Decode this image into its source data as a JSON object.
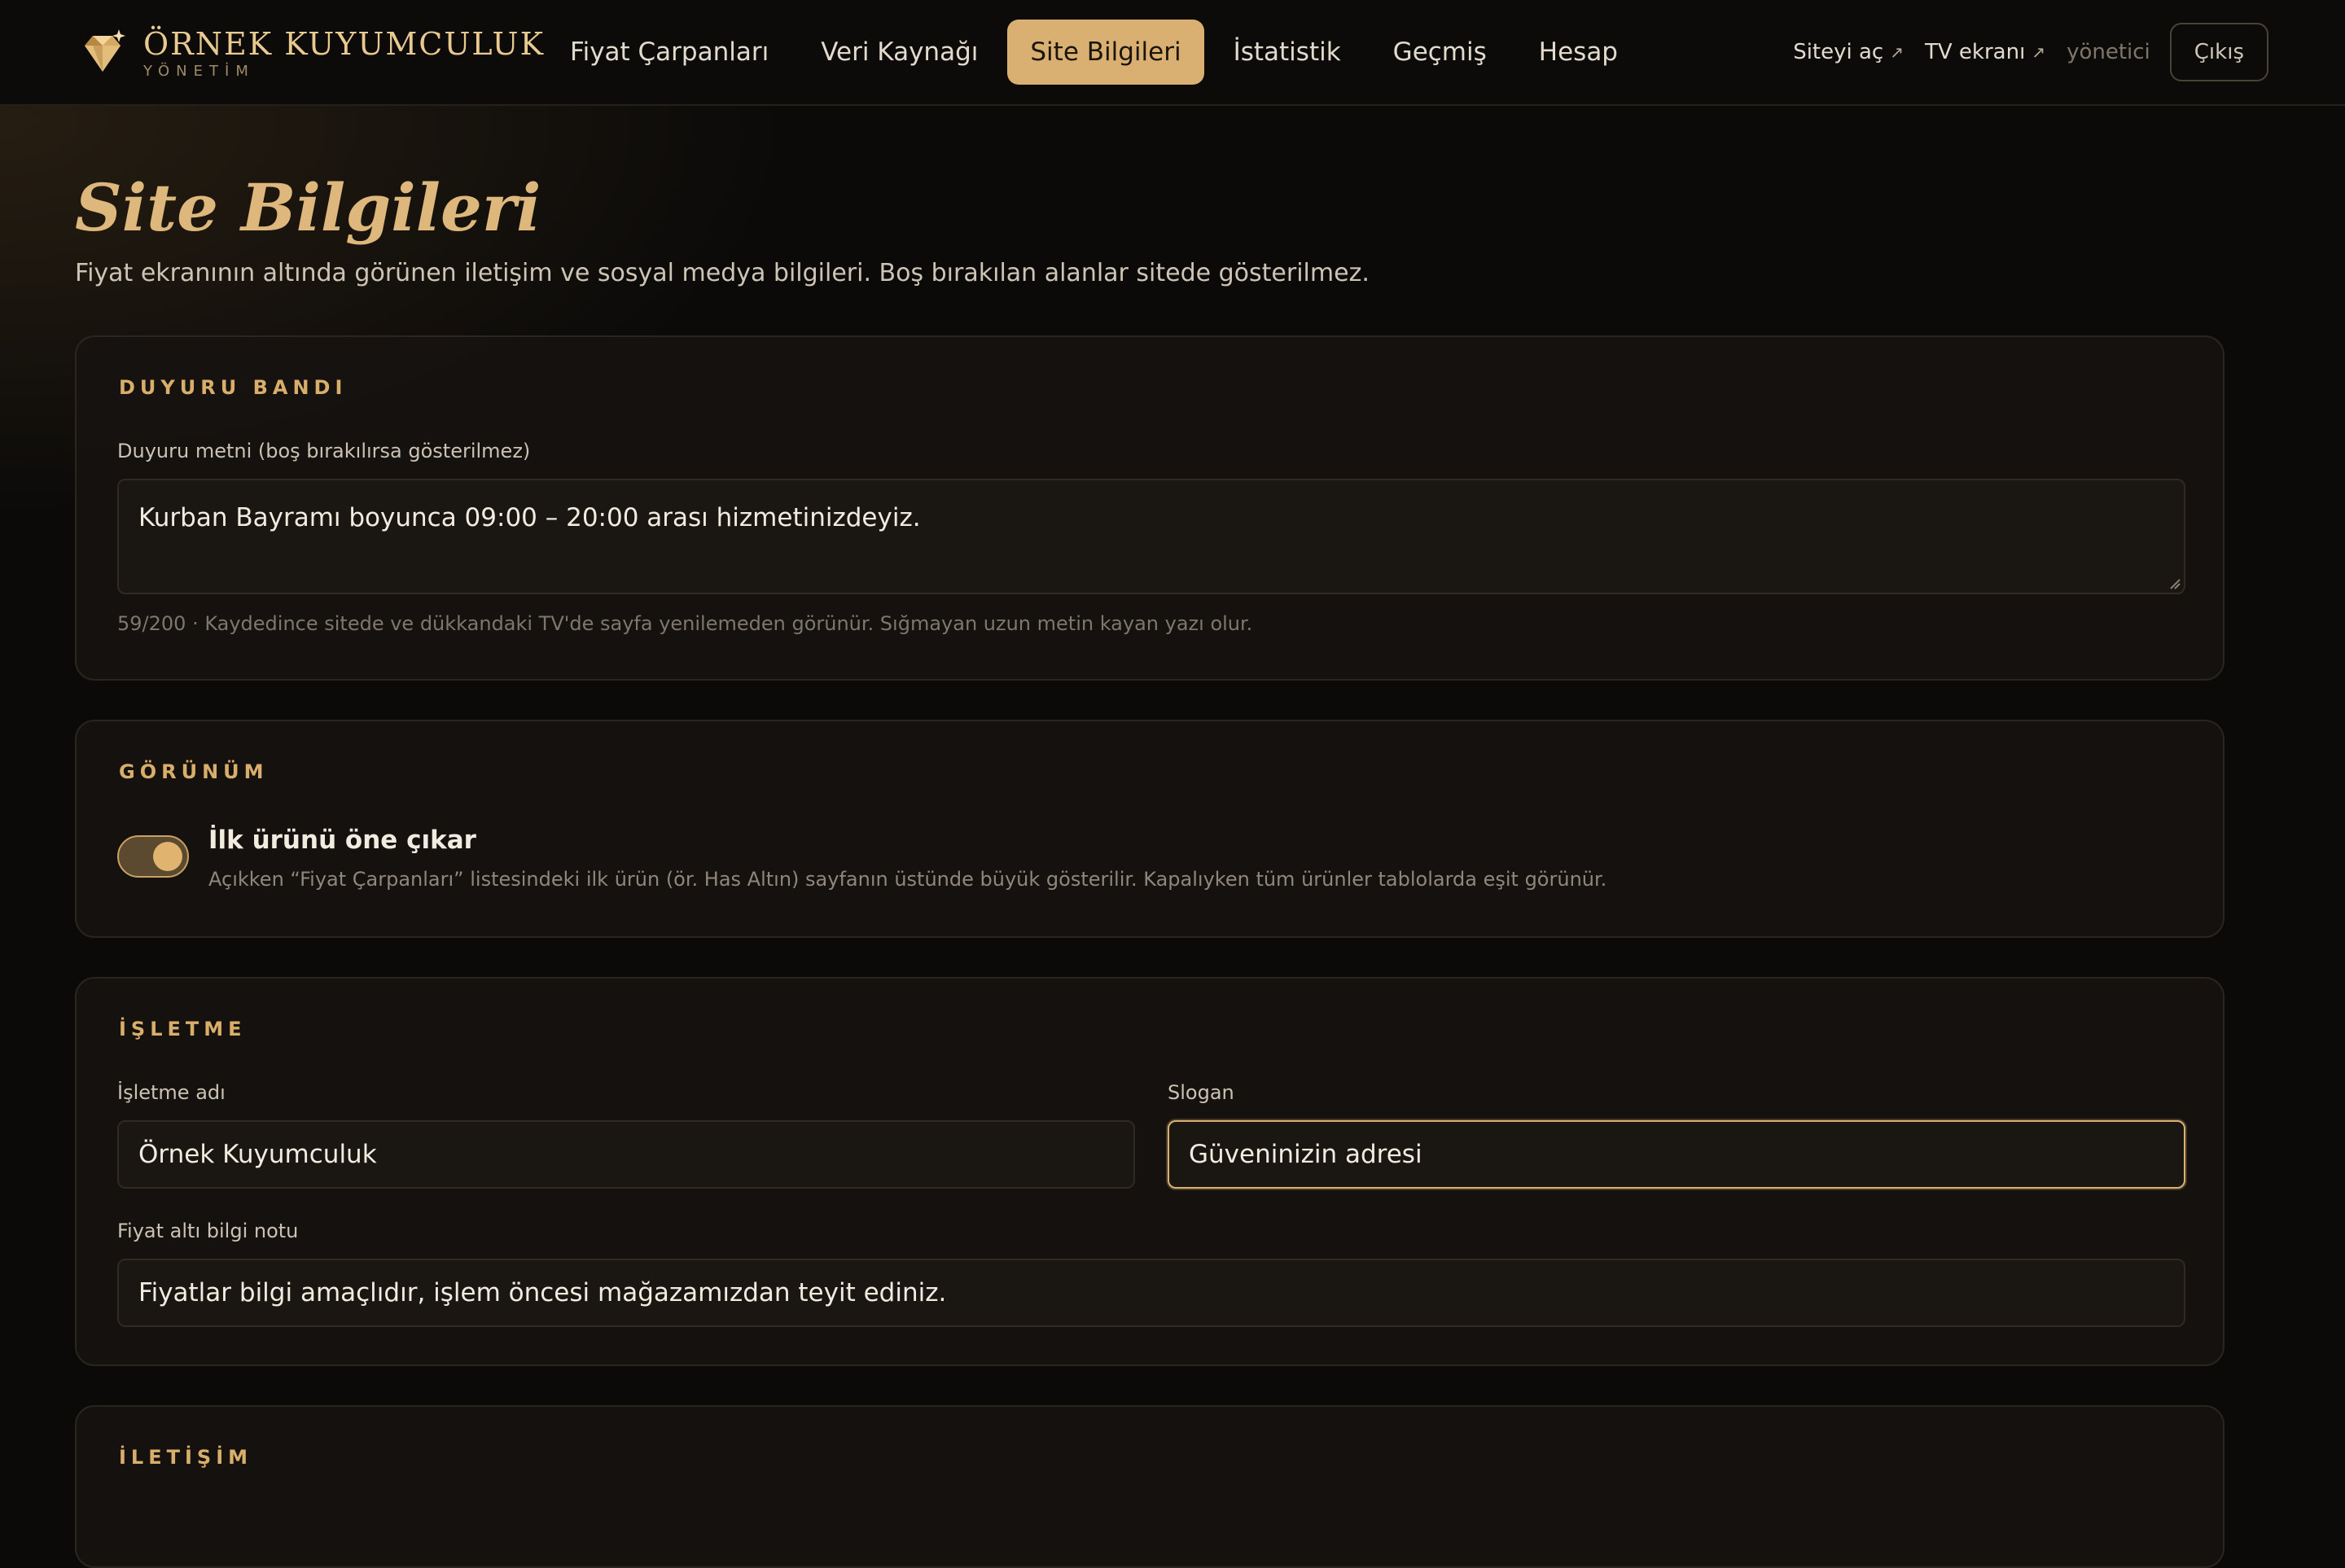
{
  "header": {
    "brand_name": "ÖRNEK KUYUMCULUK",
    "brand_sub": "YÖNETİM",
    "brand_icon": "diamond-icon",
    "nav": [
      {
        "label": "Fiyat Çarpanları",
        "active": false
      },
      {
        "label": "Veri Kaynağı",
        "active": false
      },
      {
        "label": "Site Bilgileri",
        "active": true
      },
      {
        "label": "İstatistik",
        "active": false
      },
      {
        "label": "Geçmiş",
        "active": false
      },
      {
        "label": "Hesap",
        "active": false
      }
    ],
    "open_site_label": "Siteyi aç",
    "tv_screen_label": "TV ekranı",
    "external_icon": "↗",
    "user_label": "yönetici",
    "logout_label": "Çıkış"
  },
  "page": {
    "title": "Site Bilgileri",
    "subtitle": "Fiyat ekranının altında görünen iletişim ve sosyal medya bilgileri. Boş bırakılan alanlar sitede gösterilmez."
  },
  "announcement": {
    "section_title": "DUYURU BANDI",
    "label": "Duyuru metni (boş bırakılırsa gösterilmez)",
    "value": "Kurban Bayramı boyunca 09:00 – 20:00 arası hizmetinizdeyiz.",
    "helper": "59/200 · Kaydedince sitede ve dükkandaki TV'de sayfa yenilemeden görünür. Sığmayan uzun metin kayan yazı olur."
  },
  "appearance": {
    "section_title": "GÖRÜNÜM",
    "toggle_title": "İlk ürünü öne çıkar",
    "toggle_on": true,
    "toggle_desc": "Açıkken “Fiyat Çarpanları” listesindeki ilk ürün (ör. Has Altın) sayfanın üstünde büyük gösterilir. Kapalıyken tüm ürünler tablolarda eşit görünür."
  },
  "business": {
    "section_title": "İŞLETME",
    "name_label": "İşletme adı",
    "name_value": "Örnek Kuyumculuk",
    "slogan_label": "Slogan",
    "slogan_value": "Güveninizin adresi",
    "note_label": "Fiyat altı bilgi notu",
    "note_value": "Fiyatlar bilgi amaçlıdır, işlem öncesi mağazamızdan teyit ediniz."
  },
  "contact": {
    "section_title": "İLETİŞİM"
  },
  "colors": {
    "accent": "#d9b071",
    "background": "#0b0a09",
    "card": "#161310"
  }
}
